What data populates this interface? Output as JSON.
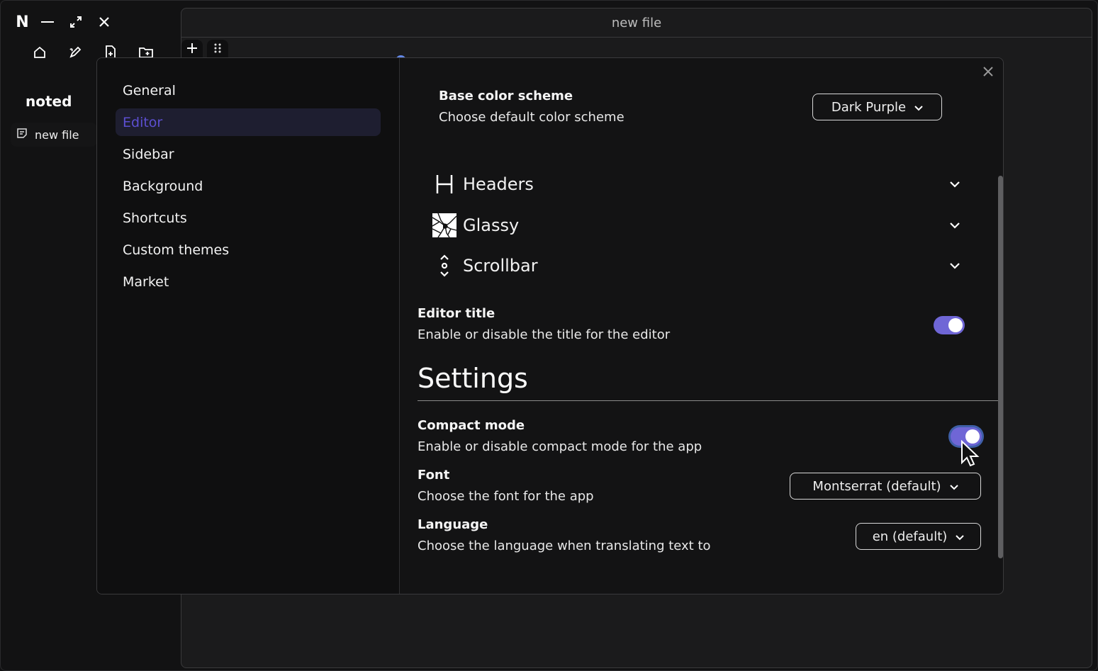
{
  "app": {
    "logo": "N",
    "window_controls": [
      "minimize-icon",
      "maximize-icon",
      "close-icon"
    ],
    "toolbar_icons": [
      "home-icon",
      "edit-icon",
      "new-file-icon",
      "new-folder-icon"
    ]
  },
  "sidebar": {
    "title": "noted",
    "files": [
      {
        "name": "new file",
        "icon": "document-icon"
      }
    ]
  },
  "editor": {
    "title": "new file",
    "toolbar": [
      "add-icon",
      "drag-grip-icon"
    ]
  },
  "settings": {
    "nav": [
      {
        "label": "General",
        "active": false
      },
      {
        "label": "Editor",
        "active": true
      },
      {
        "label": "Sidebar",
        "active": false
      },
      {
        "label": "Background",
        "active": false
      },
      {
        "label": "Shortcuts",
        "active": false
      },
      {
        "label": "Custom themes",
        "active": false
      },
      {
        "label": "Market",
        "active": false
      }
    ],
    "base_color_scheme": {
      "label": "Base color scheme",
      "description": "Choose default color scheme",
      "value": "Dark Purple"
    },
    "accordions": [
      {
        "label": "Headers",
        "icon": "heading-icon"
      },
      {
        "label": "Glassy",
        "icon": "broken-glass-icon"
      },
      {
        "label": "Scrollbar",
        "icon": "scroll-icon"
      }
    ],
    "editor_title": {
      "label": "Editor title",
      "description": "Enable or disable the title for the editor",
      "enabled": true
    },
    "section_title": "Settings",
    "compact_mode": {
      "label": "Compact mode",
      "description": "Enable or disable compact mode for the app",
      "enabled": true
    },
    "font": {
      "label": "Font",
      "description": "Choose the font for the app",
      "value": "Montserrat (default)"
    },
    "language": {
      "label": "Language",
      "description": "Choose the language when translating text to",
      "value": "en (default)"
    }
  },
  "colors": {
    "accent": "#6f66d6",
    "active_nav_text": "#5c4fd1",
    "active_nav_bg": "#1e1e30",
    "background": "#121213",
    "peek_blue": "#6388e8"
  }
}
